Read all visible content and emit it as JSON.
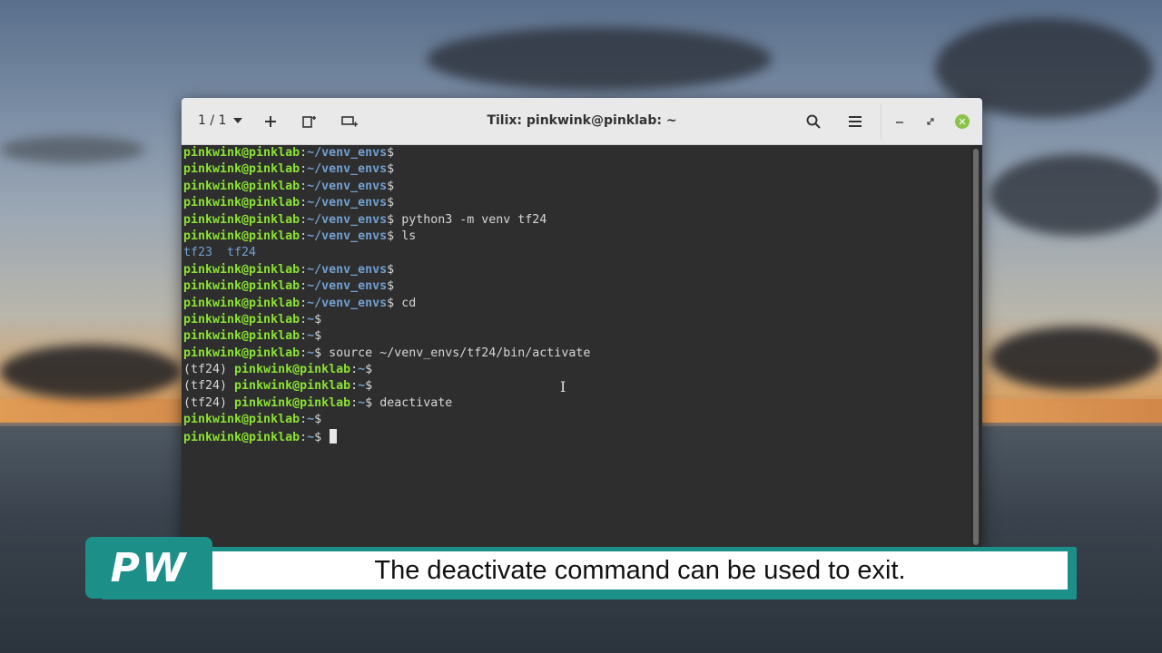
{
  "window": {
    "title": "Tilix: pinkwink@pinklab: ~",
    "session_counter": "1 / 1"
  },
  "icons": {
    "session_dropdown": "chevron-down-icon",
    "add": "plus-icon",
    "split_right": "split-terminal-right-icon",
    "split_down": "split-terminal-down-icon",
    "search": "search-icon",
    "menu": "hamburger-menu-icon",
    "minimize": "minimize-icon",
    "maximize": "maximize-icon",
    "close": "close-icon"
  },
  "terminal": {
    "user_host": "pinkwink@pinklab",
    "venv_dir": "~/venv_envs",
    "home": "~",
    "lines": [
      {
        "env": "",
        "path": "~/venv_envs",
        "cmd": ""
      },
      {
        "env": "",
        "path": "~/venv_envs",
        "cmd": ""
      },
      {
        "env": "",
        "path": "~/venv_envs",
        "cmd": ""
      },
      {
        "env": "",
        "path": "~/venv_envs",
        "cmd": ""
      },
      {
        "env": "",
        "path": "~/venv_envs",
        "cmd": " python3 -m venv tf24"
      },
      {
        "env": "",
        "path": "~/venv_envs",
        "cmd": " ls"
      },
      {
        "output": "tf23  tf24"
      },
      {
        "env": "",
        "path": "~/venv_envs",
        "cmd": ""
      },
      {
        "env": "",
        "path": "~/venv_envs",
        "cmd": ""
      },
      {
        "env": "",
        "path": "~/venv_envs",
        "cmd": " cd"
      },
      {
        "env": "",
        "path": "~",
        "cmd": ""
      },
      {
        "env": "",
        "path": "~",
        "cmd": ""
      },
      {
        "env": "",
        "path": "~",
        "cmd": " source ~/venv_envs/tf24/bin/activate"
      },
      {
        "env": "(tf24) ",
        "path": "~",
        "cmd": ""
      },
      {
        "env": "(tf24) ",
        "path": "~",
        "cmd": ""
      },
      {
        "env": "(tf24) ",
        "path": "~",
        "cmd": " deactivate"
      },
      {
        "env": "",
        "path": "~",
        "cmd": ""
      },
      {
        "env": "",
        "path": "~",
        "cmd": " ",
        "cursor": true
      }
    ]
  },
  "caption": {
    "logo": "PW",
    "text": "The deactivate command can be used to exit."
  },
  "colors": {
    "prompt_user": "#8ae234",
    "prompt_path": "#729fcf",
    "terminal_bg": "#2e2e2e",
    "caption_accent": "#1c8f88",
    "close_button": "#8bc34a"
  }
}
